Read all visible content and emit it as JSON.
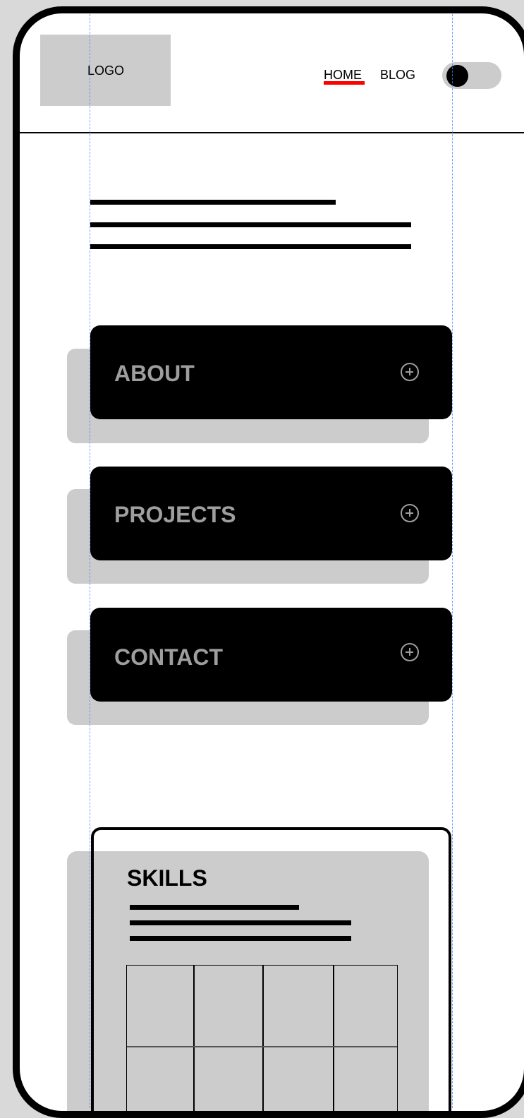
{
  "header": {
    "logo_text": "LOGO",
    "nav": [
      {
        "label": "HOME",
        "active": true
      },
      {
        "label": "BLOG",
        "active": false
      }
    ],
    "active_underline_color": "#ff0000",
    "theme_toggle_icon": "toggle-switch-icon"
  },
  "cards": [
    {
      "label": "ABOUT",
      "icon": "plus-circle-icon"
    },
    {
      "label": "PROJECTS",
      "icon": "plus-circle-icon"
    },
    {
      "label": "CONTACT",
      "icon": "plus-circle-icon"
    }
  ],
  "skills": {
    "title": "SKILLS"
  },
  "colors": {
    "card_background": "#000000",
    "card_label": "#9e9e9e",
    "placeholder_gray": "#cccccc",
    "guide_line": "#4a7dff"
  }
}
